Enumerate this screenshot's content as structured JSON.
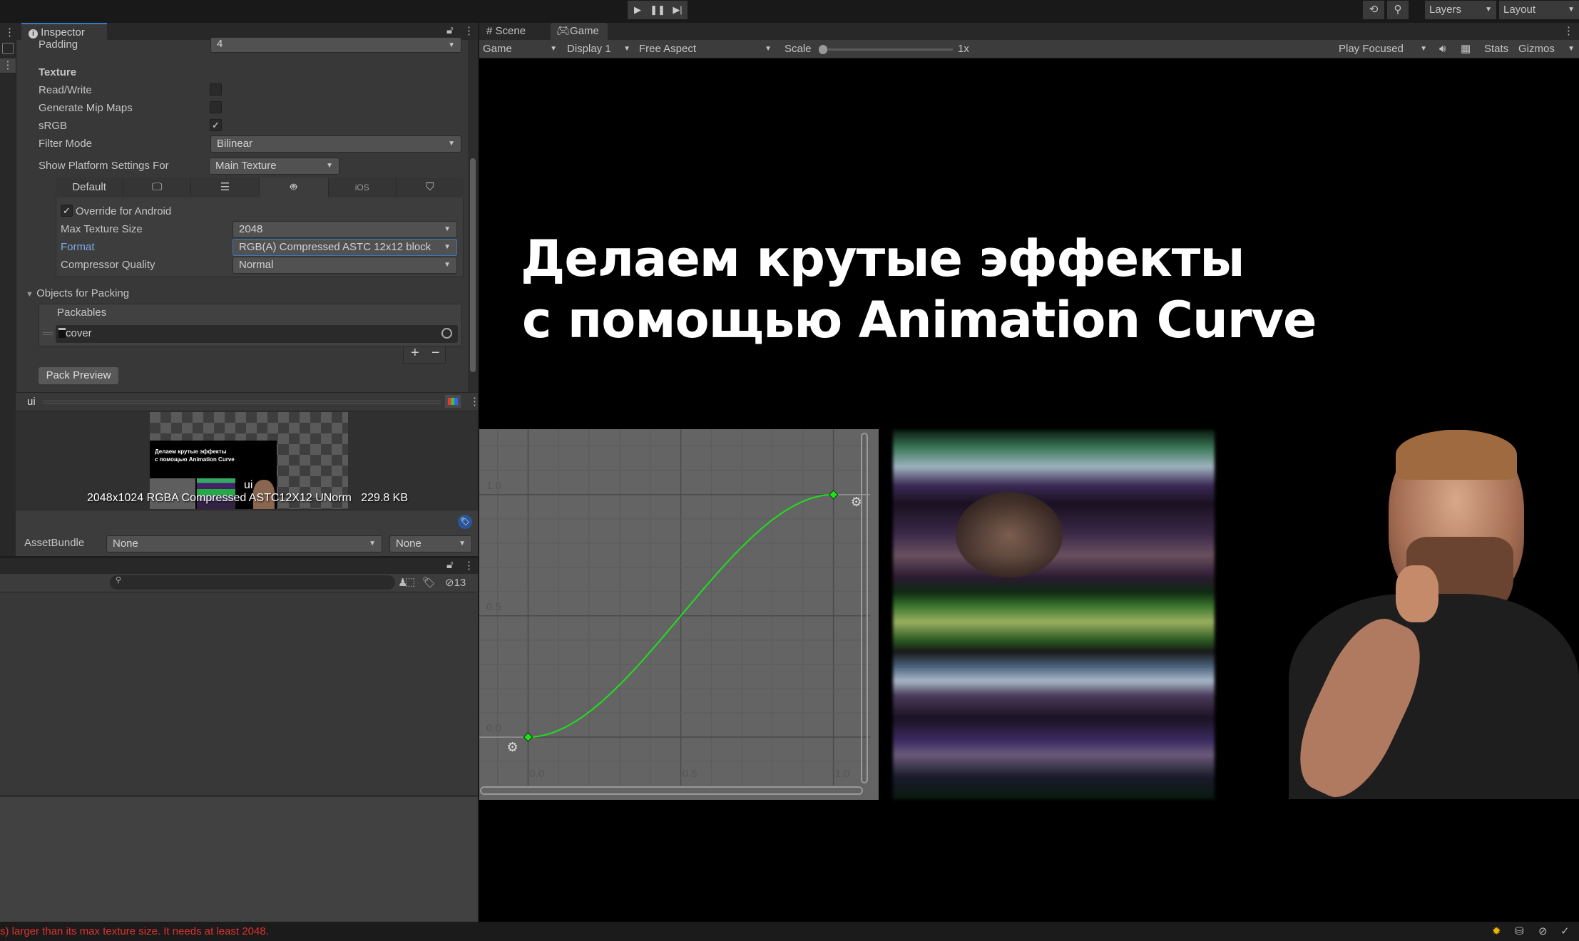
{
  "toolbar": {
    "play_icon": "play-icon",
    "pause_icon": "pause-icon",
    "step_icon": "step-icon",
    "layers": "Layers",
    "layout": "Layout"
  },
  "inspector": {
    "tab": "Inspector",
    "padding_label": "Padding",
    "padding_value": "4",
    "texture_header": "Texture",
    "read_write": "Read/Write",
    "read_write_checked": false,
    "mipmaps": "Generate Mip Maps",
    "mipmaps_checked": false,
    "srgb": "sRGB",
    "srgb_checked": true,
    "filter_label": "Filter Mode",
    "filter_value": "Bilinear",
    "platform_label": "Show Platform Settings For",
    "platform_value": "Main Texture",
    "platform_tabs": [
      "Default",
      "standalone",
      "server",
      "android",
      "iOS",
      "webgl"
    ],
    "override": "Override for Android",
    "max_size_label": "Max Texture Size",
    "max_size_value": "2048",
    "format_label": "Format",
    "format_value": "RGB(A) Compressed ASTC 12x12 block",
    "quality_label": "Compressor Quality",
    "quality_value": "Normal",
    "objects_header": "Objects for Packing",
    "packables_header": "Packables",
    "packable_item": "cover",
    "pack_preview": "Pack Preview",
    "preview_title": "ui",
    "preview_info": "2048x1024 RGBA Compressed ASTC12X12 UNorm   229.8 KB",
    "preview_overlay": "ui",
    "assetbundle_label": "AssetBundle",
    "assetbundle_value": "None",
    "assetbundle_variant": "None"
  },
  "project": {
    "hidden_count": "13"
  },
  "status": {
    "message": "s) larger than its max texture size. It needs at least 2048.",
    "error_color": "#e03030"
  },
  "game": {
    "tabs": [
      "Scene",
      "Game"
    ],
    "mode": "Game",
    "display": "Display 1",
    "aspect": "Free Aspect",
    "scale_label": "Scale",
    "scale_value": "1x",
    "play_focused": "Play Focused",
    "stats": "Stats",
    "gizmos": "Gizmos",
    "title_line1": "Делаем крутые эффекты",
    "title_line2": "с помощью Animation Curve",
    "thumb_line1": "Делаем крутые эффекты",
    "thumb_line2": "с помощью Animation Curve"
  },
  "chart_data": {
    "type": "line",
    "x_ticks": [
      "0.0",
      "0.5",
      "1.0"
    ],
    "y_ticks": [
      "0.0",
      "0.5",
      "1.0"
    ],
    "xlim": [
      -0.16,
      1.12
    ],
    "ylim": [
      -0.2,
      1.27
    ],
    "keys": [
      {
        "time": 0,
        "value": 0,
        "tangent": 0
      },
      {
        "time": 1,
        "value": 1,
        "tangent": 0
      }
    ],
    "curve_color": "#1ee01e",
    "grid": true
  }
}
